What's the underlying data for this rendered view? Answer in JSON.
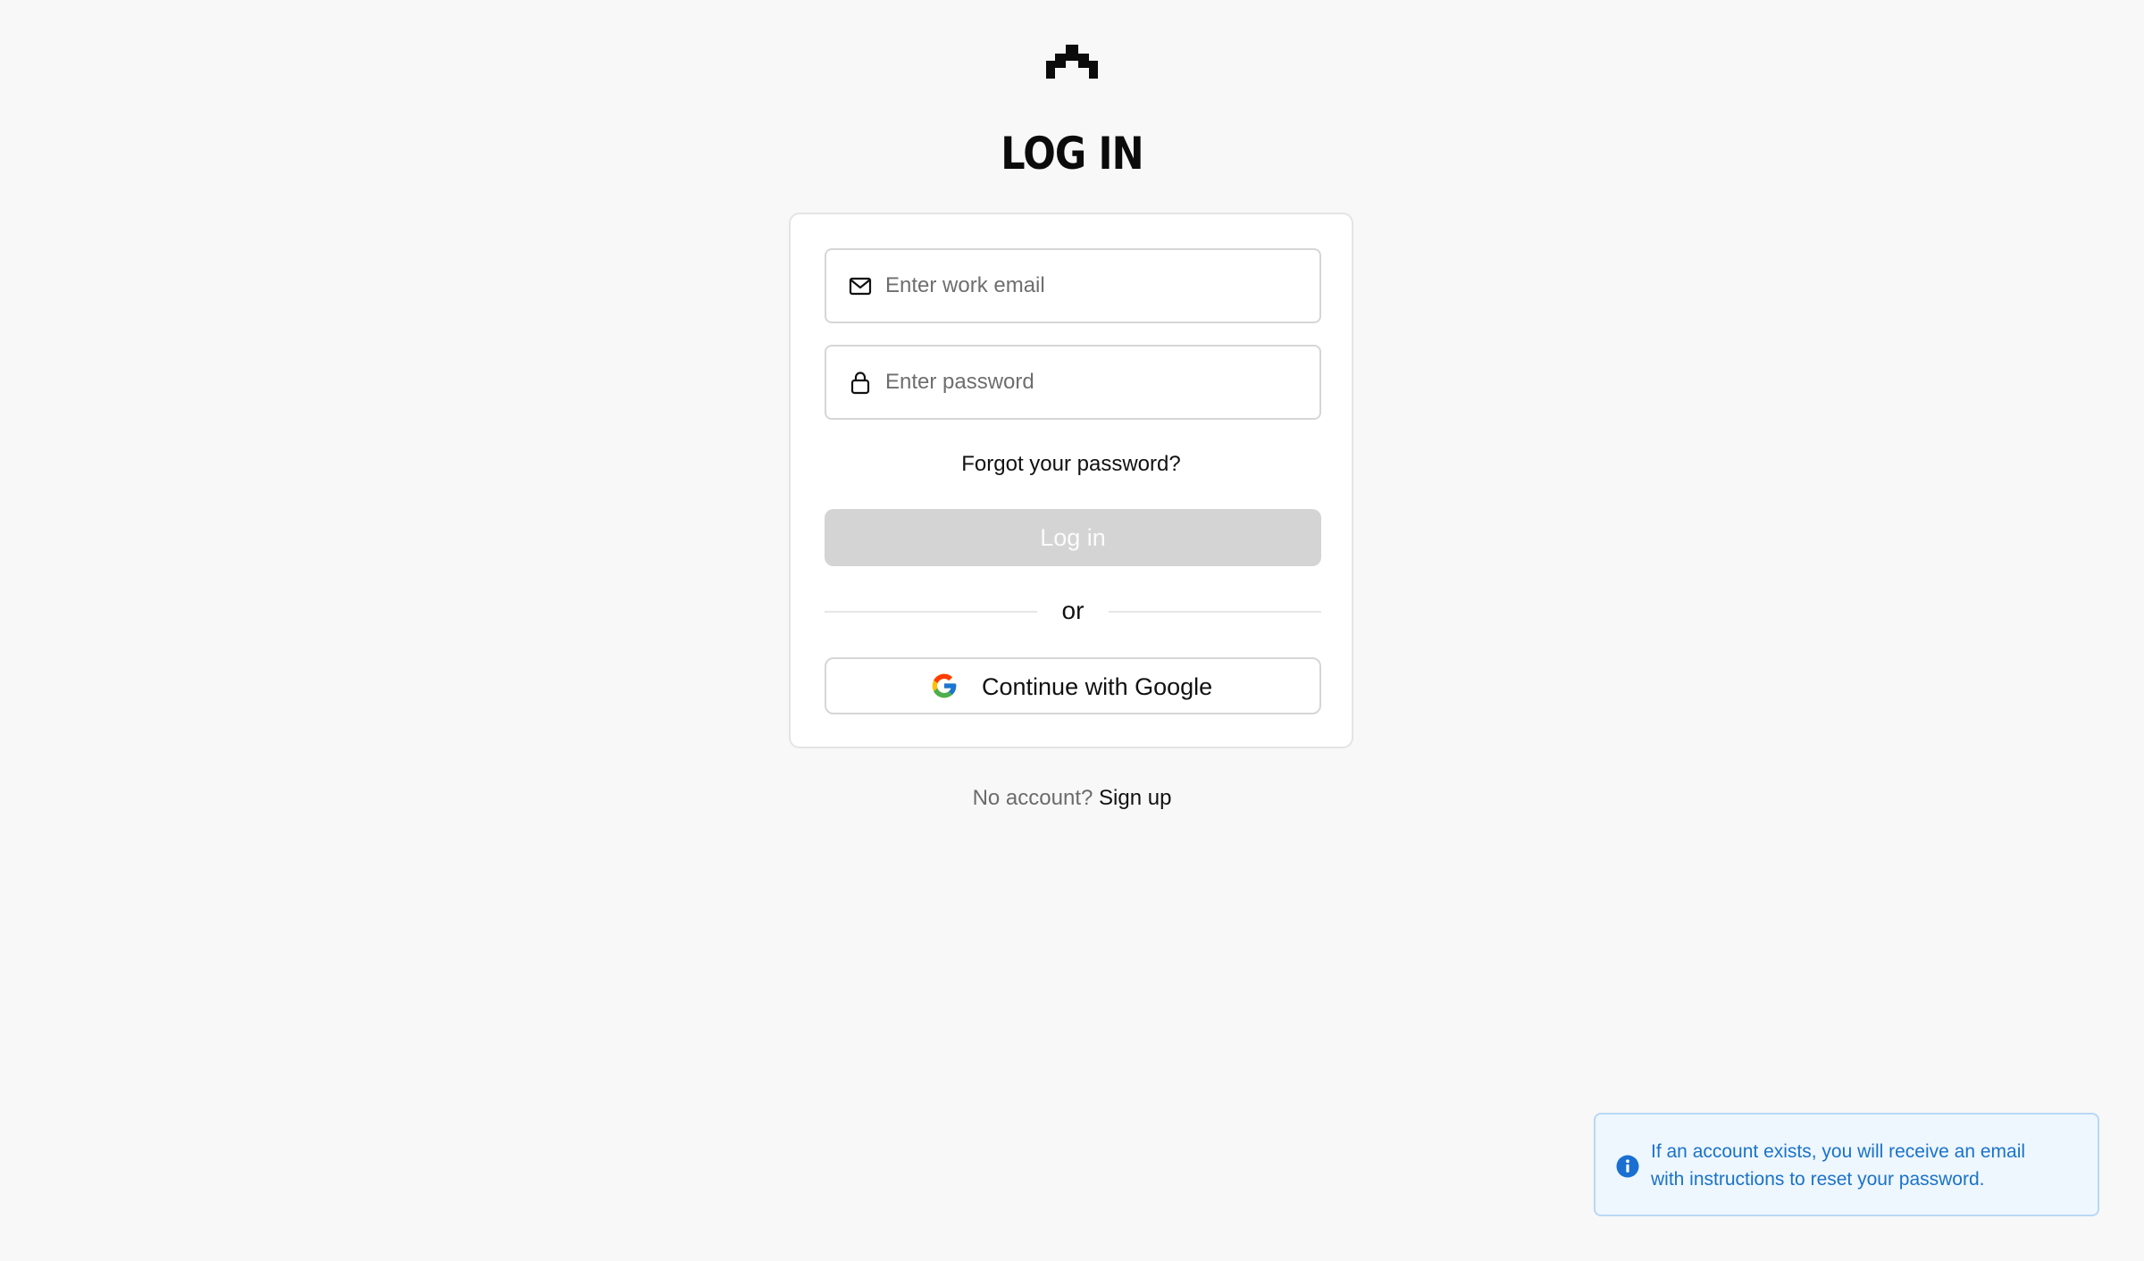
{
  "header": {
    "logo_icon": "brand-logo-icon",
    "title": "LOG IN"
  },
  "form": {
    "email": {
      "icon": "mail-icon",
      "placeholder": "Enter work email",
      "value": ""
    },
    "password": {
      "icon": "lock-icon",
      "placeholder": "Enter password",
      "value": ""
    },
    "forgot_label": "Forgot your password?",
    "login_label": "Log in",
    "divider_label": "or",
    "google_label": "Continue with Google",
    "google_icon": "google-icon"
  },
  "footer": {
    "prompt": "No account?",
    "signup_label": "Sign up"
  },
  "toast": {
    "icon": "info-icon",
    "line1": "If an account exists, you will receive an email",
    "line2": "with instructions to reset your password."
  },
  "colors": {
    "background": "#f8f8f8",
    "login_disabled": "#d4d4d4",
    "toast_bg": "#eef6fe",
    "toast_text": "#1a73c9"
  }
}
